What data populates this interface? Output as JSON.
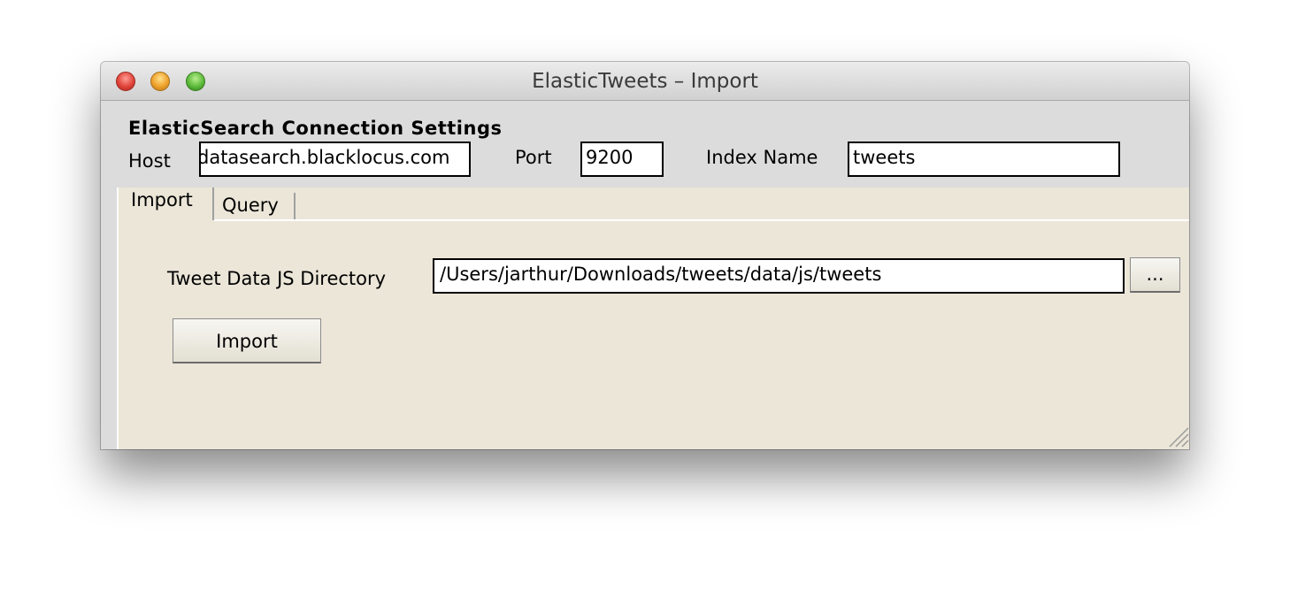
{
  "window": {
    "title": "ElasticTweets – Import"
  },
  "settings": {
    "heading": "ElasticSearch Connection Settings",
    "host_label": "Host",
    "host_value": "datasearch.blacklocus.com",
    "port_label": "Port",
    "port_value": "9200",
    "index_label": "Index Name",
    "index_value": "tweets"
  },
  "tabs": [
    {
      "label": "Import",
      "active": true
    },
    {
      "label": "Query",
      "active": false
    }
  ],
  "import_panel": {
    "dir_label": "Tweet Data JS Directory",
    "dir_value": "/Users/jarthur/Downloads/tweets/data/js/tweets",
    "browse_label": "...",
    "import_label": "Import"
  },
  "icons": [
    "close-icon",
    "minimize-icon",
    "zoom-icon",
    "resize-grip-icon"
  ],
  "colors": {
    "panel_bg": "#ebe6d8",
    "window_bg": "#dcdcdc"
  }
}
